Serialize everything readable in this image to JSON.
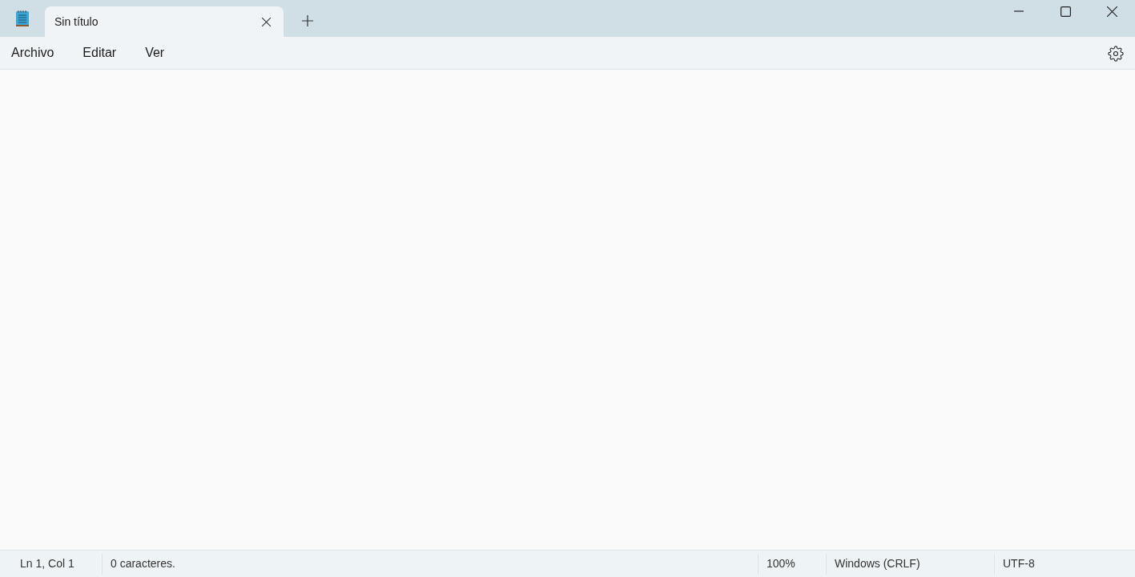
{
  "tabs": [
    {
      "title": "Sin título",
      "selected": true
    }
  ],
  "menu": [
    "Archivo",
    "Editar",
    "Ver"
  ],
  "status_bar": [
    "Ln 1, Col 1",
    "0 caracteres.",
    "100%",
    "Windows (CRLF)",
    "UTF-8"
  ]
}
